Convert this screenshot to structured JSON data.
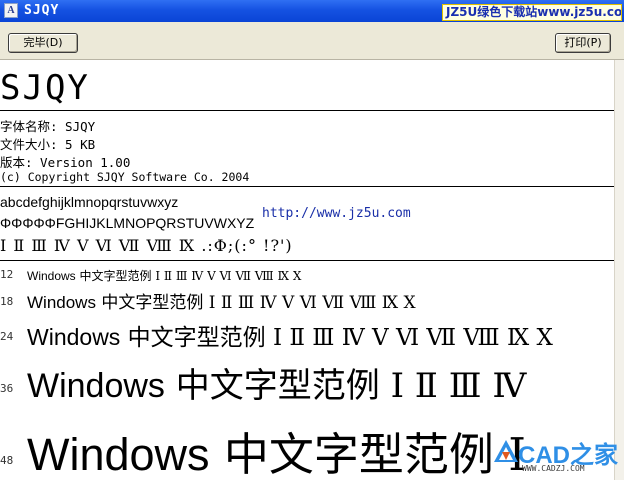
{
  "window": {
    "title": "SJQY",
    "icon_glyph": "A",
    "watermark_top": "JZ5U绿色下载站www.jz5u.com"
  },
  "toolbar": {
    "done_label": "完毕(D)",
    "print_label": "打印(P)"
  },
  "font": {
    "display_name": "SJQY",
    "info": {
      "name": "字体名称: SJQY",
      "size": "文件大小: 5 KB",
      "version": "版本: Version 1.00",
      "copyright": "(c) Copyright SJQY Software Co. 2004"
    }
  },
  "samples": {
    "lowercase": "abcdefghijklmnopqrstuvwxyz",
    "uppercase": "ΦΦΦΦΦFGHIJKLMNOPQRSTUVWXYZ",
    "symbols": "Ⅰ Ⅱ Ⅲ Ⅳ Ⅴ Ⅵ Ⅶ Ⅷ Ⅸ .:Φ;(:° !?')"
  },
  "size_rows": [
    {
      "size": "12",
      "latin": "Windows",
      "cjk": "中文字型范例",
      "roman": "Ⅰ Ⅱ Ⅲ Ⅳ Ⅴ Ⅵ Ⅶ Ⅷ Ⅸ Ⅹ"
    },
    {
      "size": "18",
      "latin": "Windows",
      "cjk": "中文字型范例",
      "roman": "Ⅰ Ⅱ Ⅲ Ⅳ Ⅴ Ⅵ Ⅶ Ⅷ Ⅸ Ⅹ"
    },
    {
      "size": "24",
      "latin": "Windows",
      "cjk": "中文字型范例",
      "roman": "Ⅰ Ⅱ Ⅲ Ⅳ Ⅴ Ⅵ Ⅶ Ⅷ Ⅸ Ⅹ"
    },
    {
      "size": "36",
      "latin": "Windows",
      "cjk": "中文字型范例",
      "roman": "Ⅰ Ⅱ Ⅲ Ⅳ"
    },
    {
      "size": "48",
      "latin": "Windows",
      "cjk": "中文字型范例",
      "roman": "Ⅰ"
    }
  ],
  "overlays": {
    "url": "http://www.jz5u.com",
    "cad_logo_main": "CAD之家",
    "cad_logo_sub": "WWW.CADZJ.COM"
  },
  "colors": {
    "titlebar": "#0a44d6",
    "toolbar": "#ece9d8",
    "url_text": "#1a2fa8",
    "logo_blue": "#2f8fe6"
  }
}
